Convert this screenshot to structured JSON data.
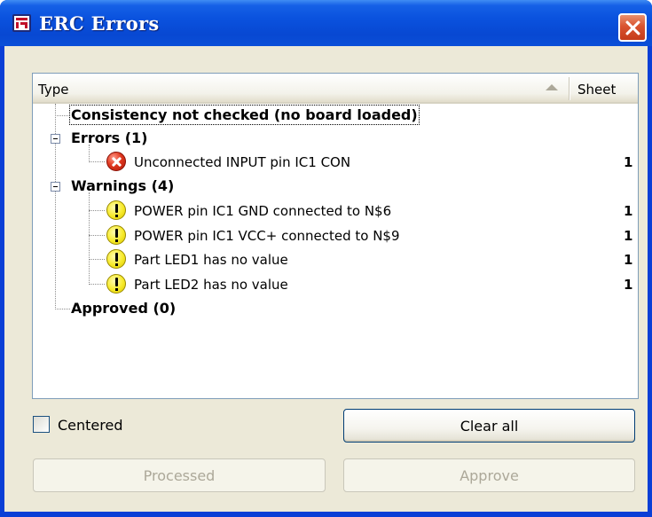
{
  "window": {
    "title": "ERC Errors"
  },
  "tree": {
    "columns": {
      "type": "Type",
      "sheet": "Sheet"
    },
    "consistency": "Consistency not checked (no board loaded)",
    "errors": {
      "label": "Errors (1)",
      "items": [
        {
          "text": "Unconnected INPUT pin IC1 CON",
          "sheet": "1",
          "icon": "error-icon"
        }
      ]
    },
    "warnings": {
      "label": "Warnings (4)",
      "items": [
        {
          "text": "POWER pin IC1 GND connected to N$6",
          "sheet": "1",
          "icon": "warning-icon"
        },
        {
          "text": "POWER pin IC1 VCC+ connected to N$9",
          "sheet": "1",
          "icon": "warning-icon"
        },
        {
          "text": "Part LED1 has no value",
          "sheet": "1",
          "icon": "warning-icon"
        },
        {
          "text": "Part LED2 has no value",
          "sheet": "1",
          "icon": "warning-icon"
        }
      ]
    },
    "approved": {
      "label": "Approved (0)"
    }
  },
  "controls": {
    "centered_label": "Centered",
    "centered_checked": false,
    "clear_all": "Clear all",
    "processed": "Processed",
    "approve": "Approve"
  },
  "colors": {
    "titlebar": "#0a52de",
    "client": "#ece9d8",
    "error": "#e0381f",
    "warning": "#f7ea2a"
  }
}
